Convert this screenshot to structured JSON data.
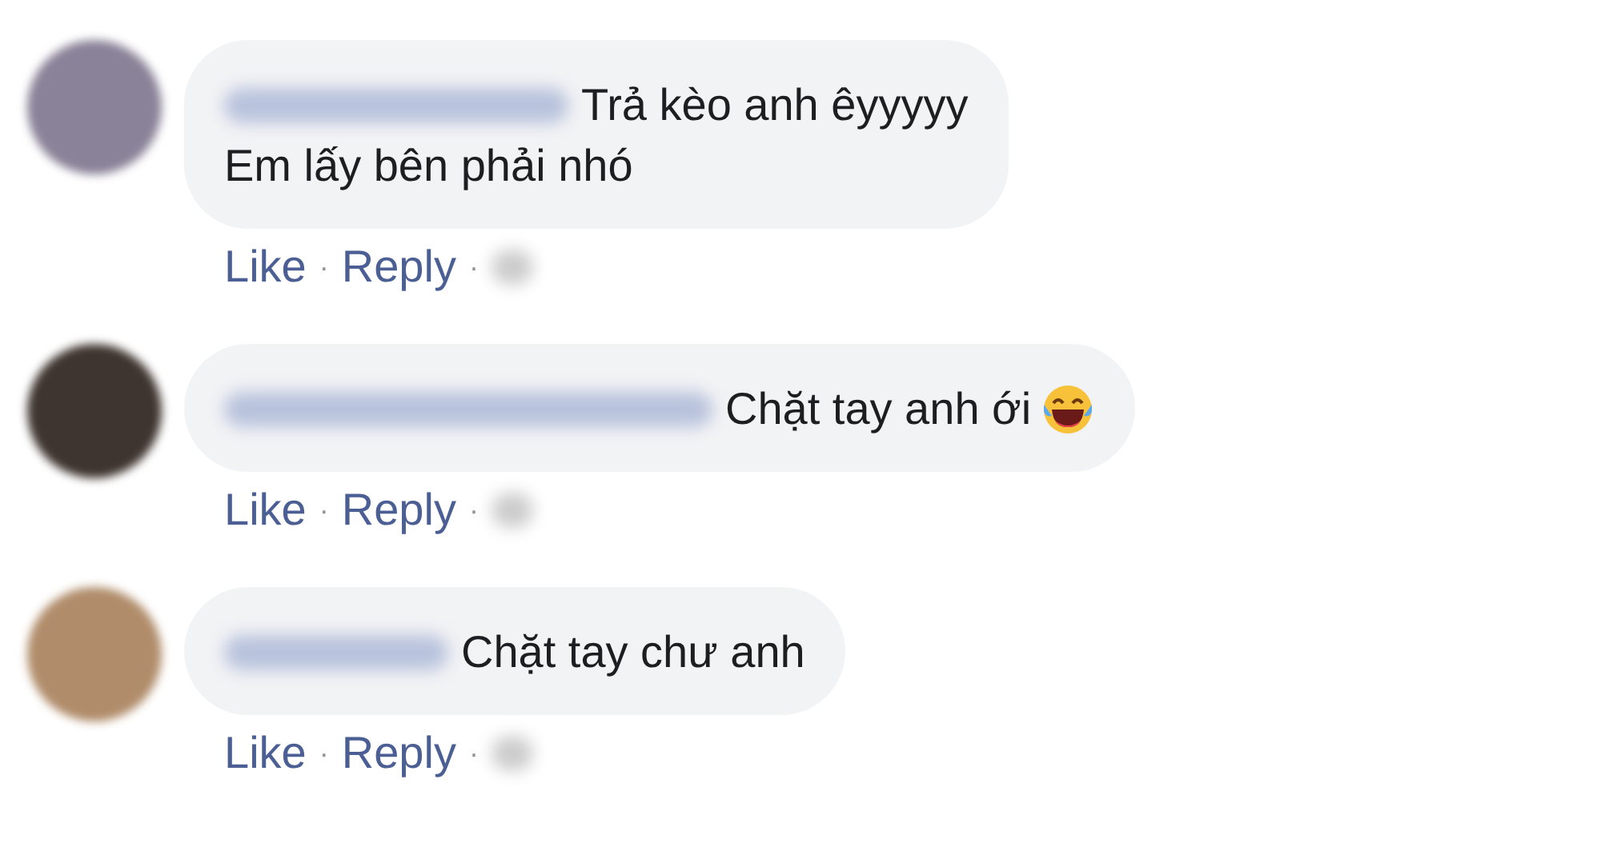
{
  "comments": [
    {
      "lines": [
        "Trả kèo anh êyyyyy",
        "Em lấy bên phải nhó"
      ],
      "emoji": false,
      "like": "Like",
      "separator": "·",
      "reply": "Reply"
    },
    {
      "lines": [
        "Chặt tay anh ới"
      ],
      "emoji": true,
      "like": "Like",
      "separator": "·",
      "reply": "Reply"
    },
    {
      "lines": [
        "Chặt tay chư anh"
      ],
      "emoji": false,
      "like": "Like",
      "separator": "·",
      "reply": "Reply"
    }
  ]
}
